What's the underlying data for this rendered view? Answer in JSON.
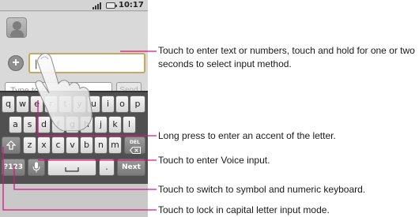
{
  "status_bar": {
    "time": "10:17"
  },
  "compose": {
    "to_cursor": "|",
    "message_placeholder": "Type to c",
    "send_label": "Send"
  },
  "keyboard": {
    "row1": [
      "q",
      "w",
      "e",
      "r",
      "t",
      "y",
      "u",
      "i",
      "o",
      "p"
    ],
    "row2": [
      "a",
      "s",
      "d",
      "f",
      "g",
      "h",
      "j",
      "k",
      "l"
    ],
    "row3": [
      "z",
      "x",
      "c",
      "v",
      "b",
      "n",
      "m"
    ],
    "symbol_key": "?123",
    "period_key": ".",
    "next_key": "Next",
    "delete_key": "DEL"
  },
  "callouts": {
    "text_field": "Touch to enter text or numbers, touch and hold for one or two seconds to select input method.",
    "accent": "Long press to enter an accent of the letter.",
    "voice": "Touch to enter Voice input.",
    "symbols": "Touch to switch to symbol and numeric keyboard.",
    "caps": "Touch to lock in capital letter input mode."
  },
  "colors": {
    "leader_line": "#d6177e"
  }
}
